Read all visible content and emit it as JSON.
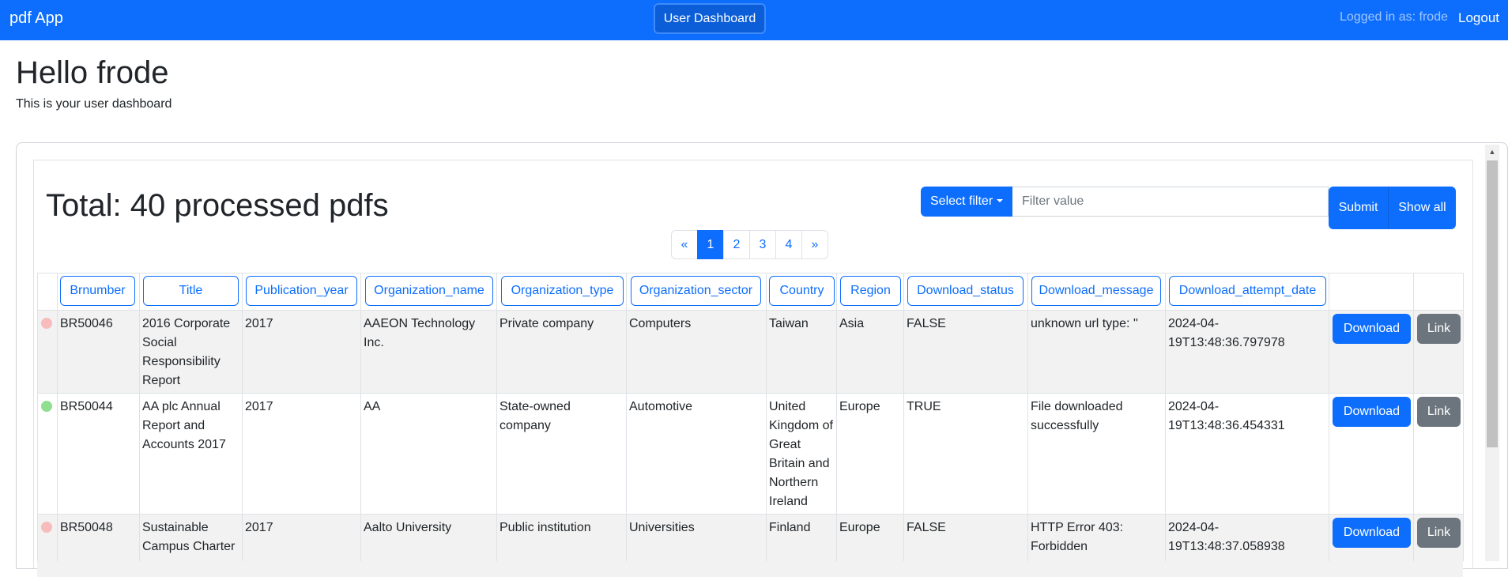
{
  "navbar": {
    "brand": "pdf App",
    "center_button": "User Dashboard",
    "logged_in": "Logged in as: frode",
    "logout": "Logout"
  },
  "page": {
    "greeting": "Hello frode",
    "subtitle": "This is your user dashboard",
    "total": "Total: 40 processed pdfs"
  },
  "filter": {
    "select_label": "Select filter",
    "input_placeholder": "Filter value",
    "submit": "Submit",
    "show_all": "Show all"
  },
  "pagination": [
    "«",
    "1",
    "2",
    "3",
    "4",
    "»"
  ],
  "pagination_active": "1",
  "table": {
    "headers": [
      "Brnumber",
      "Title",
      "Publication_year",
      "Organization_name",
      "Organization_type",
      "Organization_sector",
      "Country",
      "Region",
      "Download_status",
      "Download_message",
      "Download_attempt_date"
    ],
    "download_label": "Download",
    "link_label": "Link",
    "rows": [
      {
        "status_color": "#f8bcbc",
        "brnumber": "BR50046",
        "title": "2016 Corporate Social Responsibility Report",
        "year": "2017",
        "org_name": "AAEON Technology Inc.",
        "org_type": "Private company",
        "org_sector": "Computers",
        "country": "Taiwan",
        "region": "Asia",
        "status": "FALSE",
        "message": "unknown url type: ''",
        "date": "2024-04-19T13:48:36.797978"
      },
      {
        "status_color": "#8fdf8f",
        "brnumber": "BR50044",
        "title": "AA plc Annual Report and Accounts 2017",
        "year": "2017",
        "org_name": "AA",
        "org_type": "State-owned company",
        "org_sector": "Automotive",
        "country": "United Kingdom of Great Britain and Northern Ireland",
        "region": "Europe",
        "status": "TRUE",
        "message": "File downloaded successfully",
        "date": "2024-04-19T13:48:36.454331"
      },
      {
        "status_color": "#f8bcbc",
        "brnumber": "BR50048",
        "title": "Sustainable Campus Charter",
        "year": "2017",
        "org_name": "Aalto University",
        "org_type": "Public institution",
        "org_sector": "Universities",
        "country": "Finland",
        "region": "Europe",
        "status": "FALSE",
        "message": "HTTP Error 403: Forbidden",
        "date": "2024-04-19T13:48:37.058938"
      }
    ]
  }
}
